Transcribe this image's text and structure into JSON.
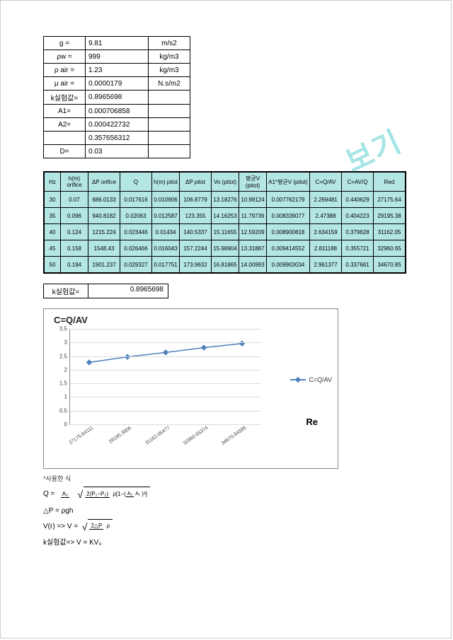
{
  "watermark": "보기",
  "params": [
    {
      "label": "g =",
      "value": "9.81",
      "unit": "m/s2"
    },
    {
      "label": "ρw =",
      "value": "999",
      "unit": "kg/m3"
    },
    {
      "label": "ρ air =",
      "value": "1.23",
      "unit": "kg/m3"
    },
    {
      "label": "μ air =",
      "value": "0.0000179",
      "unit": "N.s/m2"
    },
    {
      "label": "k실험값=",
      "value": "0.8965698",
      "unit": ""
    },
    {
      "label": "A1=",
      "value": "0.000706858",
      "unit": ""
    },
    {
      "label": "A2=",
      "value": "0.000422732",
      "unit": ""
    },
    {
      "label": "",
      "value": "0.357656312",
      "unit": ""
    },
    {
      "label": "D=",
      "value": "0.03",
      "unit": ""
    }
  ],
  "data_headers": [
    "Hz",
    "h(m) orifice",
    "ΔP orifice",
    "Q",
    "h(m) pitot",
    "ΔP pitot",
    "Vo (pitot)",
    "평균V (pitot)",
    "A1*평균V (pitot)",
    "C=Q/AV",
    "C=AV/Q",
    "Red"
  ],
  "data_rows": [
    [
      "30",
      "0.07",
      "686.0133",
      "0.017616",
      "0.010906",
      "106.8779",
      "13.18276",
      "10.98124",
      "0.007762179",
      "2.269481",
      "0.440629",
      "27175.64"
    ],
    [
      "35",
      "0.096",
      "940.8182",
      "0.02063",
      "0.012587",
      "123.355",
      "14.16253",
      "11.79739",
      "0.008339077",
      "2.47388",
      "0.404223",
      "29195.38"
    ],
    [
      "40",
      "0.124",
      "1215.224",
      "0.023446",
      "0.01434",
      "140.5337",
      "15.11655",
      "12.59209",
      "0.008900818",
      "2.634159",
      "0.379628",
      "31162.05"
    ],
    [
      "45",
      "0.158",
      "1548.43",
      "0.026466",
      "0.016043",
      "157.2244",
      "15.98904",
      "13.31887",
      "0.009414552",
      "2.811188",
      "0.355721",
      "32960.65"
    ],
    [
      "50",
      "0.194",
      "1901.237",
      "0.029327",
      "0.017751",
      "173.9632",
      "16.81865",
      "14.00993",
      "0.009903034",
      "2.961377",
      "0.337681",
      "34670.85"
    ]
  ],
  "kbox": {
    "label": "k실험값=",
    "value": "0.8965698"
  },
  "chart": {
    "title": "C=Q/AV",
    "legend": "C=Q/AV",
    "re_label": "Re",
    "yticks": [
      "0",
      "0.5",
      "1",
      "1.5",
      "2",
      "2.5",
      "3",
      "3.5"
    ],
    "xticks": [
      "27175.64111",
      "29195.3806",
      "31162.05477",
      "32960.65374",
      "34670.84585"
    ]
  },
  "chart_data": {
    "type": "line",
    "title": "C=Q/AV",
    "xlabel": "Re",
    "ylabel": "",
    "ylim": [
      0,
      3.5
    ],
    "categories": [
      "27175.64111",
      "29195.3806",
      "31162.05477",
      "32960.65374",
      "34670.84585"
    ],
    "series": [
      {
        "name": "C=Q/AV",
        "values": [
          2.269481,
          2.47388,
          2.634159,
          2.811188,
          2.961377
        ]
      }
    ]
  },
  "equations": {
    "note": "*사용한 식",
    "q_lhs": "Q  =",
    "q_num": "2(P₁−P₂)",
    "q_den_a": "ρ[1−(",
    "q_den_frac_num": "A₂",
    "q_den_frac_den": "A₁",
    "q_den_b": ")²]",
    "q_coef": "A₂",
    "dp": "△P = ρgh",
    "vr_lhs": "V(r)  =>  V =",
    "vr_num": "2△P",
    "vr_den": "ρ",
    "kexp": "k실험값=> V = KV₀"
  }
}
